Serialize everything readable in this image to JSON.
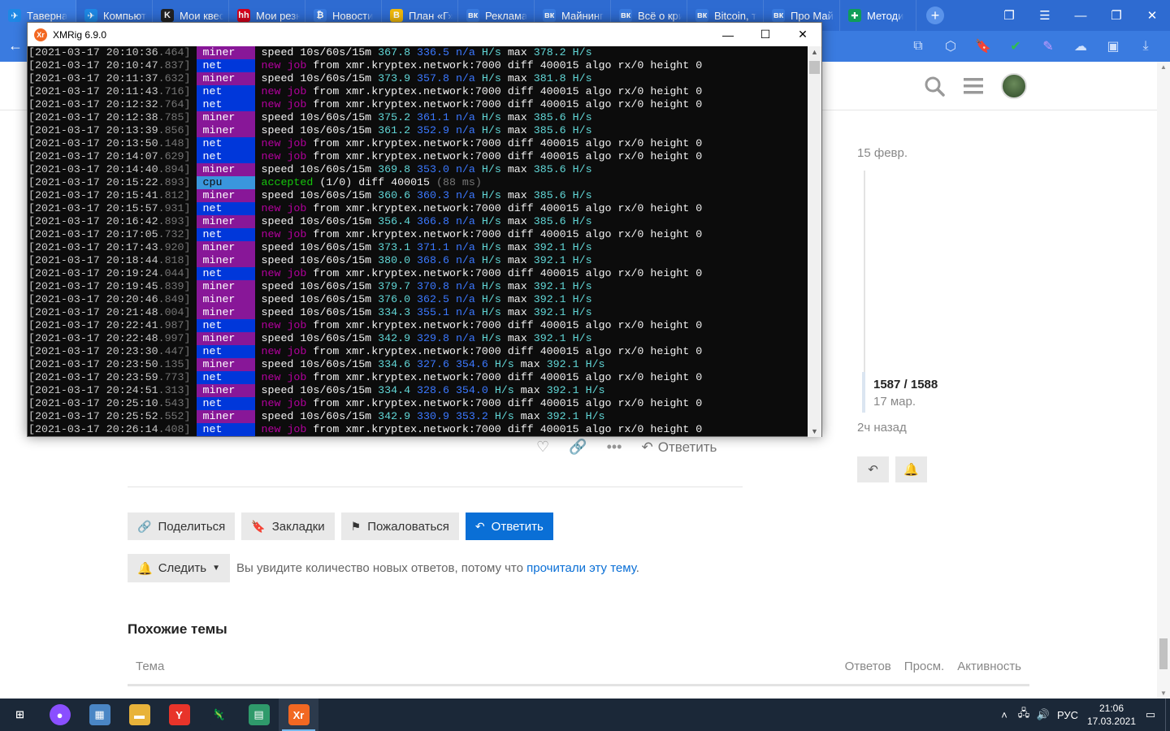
{
  "browser": {
    "tabs": [
      {
        "title": "Таверна",
        "fav_color": "#1e88e5",
        "fav_glyph": "✈",
        "active": true
      },
      {
        "title": "Компьютеры",
        "fav_color": "#1e88e5",
        "fav_glyph": "✈"
      },
      {
        "title": "Мои квесты",
        "fav_color": "#222222",
        "fav_glyph": "K"
      },
      {
        "title": "Мои резюме",
        "fav_color": "#d6001c",
        "fav_glyph": "hh"
      },
      {
        "title": "Новости",
        "fav_color": "#3a7be0",
        "fav_glyph": "₿"
      },
      {
        "title": "План «Г»",
        "fav_color": "#f0b90b",
        "fav_glyph": "B"
      },
      {
        "title": "Реклама",
        "fav_color": "#3a7be0",
        "fav_glyph": "вк"
      },
      {
        "title": "Майнинг",
        "fav_color": "#3a7be0",
        "fav_glyph": "вк"
      },
      {
        "title": "Всё о крипте",
        "fav_color": "#3a7be0",
        "fav_glyph": "вк"
      },
      {
        "title": "Bitcoin, т",
        "fav_color": "#3a7be0",
        "fav_glyph": "вк"
      },
      {
        "title": "Про Майнинг",
        "fav_color": "#3a7be0",
        "fav_glyph": "вк"
      },
      {
        "title": "Методи",
        "fav_color": "#0f9d58",
        "fav_glyph": "✚"
      }
    ],
    "new_tab": "+"
  },
  "forum": {
    "timeline": {
      "top_date": "15 февр.",
      "position": "1587 / 1588",
      "position_date": "17 мар.",
      "bottom_label": "2ч назад"
    },
    "post_actions": {
      "reply": "Ответить"
    },
    "footer_buttons": {
      "share": "Поделиться",
      "bookmarks": "Закладки",
      "report": "Пожаловаться",
      "reply": "Ответить"
    },
    "notification": {
      "button": "Следить",
      "text_before": "Вы увидите количество новых ответов, потому что ",
      "link": "прочитали эту тему",
      "text_after": "."
    },
    "similar": {
      "title": "Похожие темы",
      "col_topic": "Тема",
      "col_replies": "Ответов",
      "col_views": "Просм.",
      "col_activity": "Активность"
    }
  },
  "console": {
    "title": "XMRig 6.9.0",
    "logo": "Xr",
    "lines": [
      {
        "ts": "[2021-03-17 20:10:36",
        "ms": ".464]",
        "tag": "miner",
        "kind": "speed",
        "s10": "367.8",
        "s60": "336.5",
        "s15": "n/a",
        "max": "378.2"
      },
      {
        "ts": "[2021-03-17 20:10:47",
        "ms": ".837]",
        "tag": "net",
        "kind": "job"
      },
      {
        "ts": "[2021-03-17 20:11:37",
        "ms": ".632]",
        "tag": "miner",
        "kind": "speed",
        "s10": "373.9",
        "s60": "357.8",
        "s15": "n/a",
        "max": "381.8"
      },
      {
        "ts": "[2021-03-17 20:11:43",
        "ms": ".716]",
        "tag": "net",
        "kind": "job"
      },
      {
        "ts": "[2021-03-17 20:12:32",
        "ms": ".764]",
        "tag": "net",
        "kind": "job"
      },
      {
        "ts": "[2021-03-17 20:12:38",
        "ms": ".785]",
        "tag": "miner",
        "kind": "speed",
        "s10": "375.2",
        "s60": "361.1",
        "s15": "n/a",
        "max": "385.6"
      },
      {
        "ts": "[2021-03-17 20:13:39",
        "ms": ".856]",
        "tag": "miner",
        "kind": "speed",
        "s10": "361.2",
        "s60": "352.9",
        "s15": "n/a",
        "max": "385.6"
      },
      {
        "ts": "[2021-03-17 20:13:50",
        "ms": ".148]",
        "tag": "net",
        "kind": "job"
      },
      {
        "ts": "[2021-03-17 20:14:07",
        "ms": ".629]",
        "tag": "net",
        "kind": "job"
      },
      {
        "ts": "[2021-03-17 20:14:40",
        "ms": ".894]",
        "tag": "miner",
        "kind": "speed",
        "s10": "369.8",
        "s60": "353.0",
        "s15": "n/a",
        "max": "385.6"
      },
      {
        "ts": "[2021-03-17 20:15:22",
        "ms": ".893]",
        "tag": "cpu",
        "kind": "accepted",
        "count": "(1/0)",
        "diff": "400015",
        "time": "(88 ms)"
      },
      {
        "ts": "[2021-03-17 20:15:41",
        "ms": ".812]",
        "tag": "miner",
        "kind": "speed",
        "s10": "360.6",
        "s60": "360.3",
        "s15": "n/a",
        "max": "385.6"
      },
      {
        "ts": "[2021-03-17 20:15:57",
        "ms": ".931]",
        "tag": "net",
        "kind": "job"
      },
      {
        "ts": "[2021-03-17 20:16:42",
        "ms": ".893]",
        "tag": "miner",
        "kind": "speed",
        "s10": "356.4",
        "s60": "366.8",
        "s15": "n/a",
        "max": "385.6"
      },
      {
        "ts": "[2021-03-17 20:17:05",
        "ms": ".732]",
        "tag": "net",
        "kind": "job"
      },
      {
        "ts": "[2021-03-17 20:17:43",
        "ms": ".920]",
        "tag": "miner",
        "kind": "speed",
        "s10": "373.1",
        "s60": "371.1",
        "s15": "n/a",
        "max": "392.1"
      },
      {
        "ts": "[2021-03-17 20:18:44",
        "ms": ".818]",
        "tag": "miner",
        "kind": "speed",
        "s10": "380.0",
        "s60": "368.6",
        "s15": "n/a",
        "max": "392.1"
      },
      {
        "ts": "[2021-03-17 20:19:24",
        "ms": ".044]",
        "tag": "net",
        "kind": "job"
      },
      {
        "ts": "[2021-03-17 20:19:45",
        "ms": ".839]",
        "tag": "miner",
        "kind": "speed",
        "s10": "379.7",
        "s60": "370.8",
        "s15": "n/a",
        "max": "392.1"
      },
      {
        "ts": "[2021-03-17 20:20:46",
        "ms": ".849]",
        "tag": "miner",
        "kind": "speed",
        "s10": "376.0",
        "s60": "362.5",
        "s15": "n/a",
        "max": "392.1"
      },
      {
        "ts": "[2021-03-17 20:21:48",
        "ms": ".004]",
        "tag": "miner",
        "kind": "speed",
        "s10": "334.3",
        "s60": "355.1",
        "s15": "n/a",
        "max": "392.1"
      },
      {
        "ts": "[2021-03-17 20:22:41",
        "ms": ".987]",
        "tag": "net",
        "kind": "job"
      },
      {
        "ts": "[2021-03-17 20:22:48",
        "ms": ".997]",
        "tag": "miner",
        "kind": "speed",
        "s10": "342.9",
        "s60": "329.8",
        "s15": "n/a",
        "max": "392.1"
      },
      {
        "ts": "[2021-03-17 20:23:30",
        "ms": ".447]",
        "tag": "net",
        "kind": "job"
      },
      {
        "ts": "[2021-03-17 20:23:50",
        "ms": ".135]",
        "tag": "miner",
        "kind": "speed",
        "s10": "334.6",
        "s60": "327.6",
        "s15": "354.6",
        "max": "392.1"
      },
      {
        "ts": "[2021-03-17 20:23:59",
        "ms": ".773]",
        "tag": "net",
        "kind": "job"
      },
      {
        "ts": "[2021-03-17 20:24:51",
        "ms": ".313]",
        "tag": "miner",
        "kind": "speed",
        "s10": "334.4",
        "s60": "328.6",
        "s15": "354.0",
        "max": "392.1"
      },
      {
        "ts": "[2021-03-17 20:25:10",
        "ms": ".543]",
        "tag": "net",
        "kind": "job"
      },
      {
        "ts": "[2021-03-17 20:25:52",
        "ms": ".552]",
        "tag": "miner",
        "kind": "speed",
        "s10": "342.9",
        "s60": "330.9",
        "s15": "353.2",
        "max": "392.1"
      },
      {
        "ts": "[2021-03-17 20:26:14",
        "ms": ".408]",
        "tag": "net",
        "kind": "job"
      }
    ],
    "speed_words": {
      "label": "speed",
      "periods": "10s/60s/15m",
      "unit": "H/s",
      "max": "max"
    },
    "job_words": {
      "new": "new",
      "job": "job",
      "from": "from",
      "pool": "xmr.kryptex.network:7000",
      "diff": "diff",
      "diff_value": "400015",
      "algo": "algo",
      "algo_value": "rx/0",
      "height": "height",
      "height_value": "0"
    },
    "accepted_words": {
      "accepted": "accepted",
      "diff": "diff"
    }
  },
  "taskbar": {
    "apps": [
      {
        "name": "start",
        "glyph": "⊞",
        "color": "#1b2838"
      },
      {
        "name": "alice",
        "glyph": "●",
        "color": "#8a4fff"
      },
      {
        "name": "calculator",
        "glyph": "▦",
        "color": "#4a86c5"
      },
      {
        "name": "explorer",
        "glyph": "▬",
        "color": "#e8b33a"
      },
      {
        "name": "yandex-browser",
        "glyph": "Y",
        "color": "#e8342a"
      },
      {
        "name": "dino-app",
        "glyph": "🦎",
        "color": "#1b2838"
      },
      {
        "name": "notepad-app",
        "glyph": "▤",
        "color": "#2f9a6b"
      },
      {
        "name": "xmrig",
        "glyph": "Xr",
        "color": "#f26822",
        "active": true
      }
    ],
    "tray": {
      "lang": "РУС",
      "time": "21:06",
      "date": "17.03.2021"
    }
  }
}
